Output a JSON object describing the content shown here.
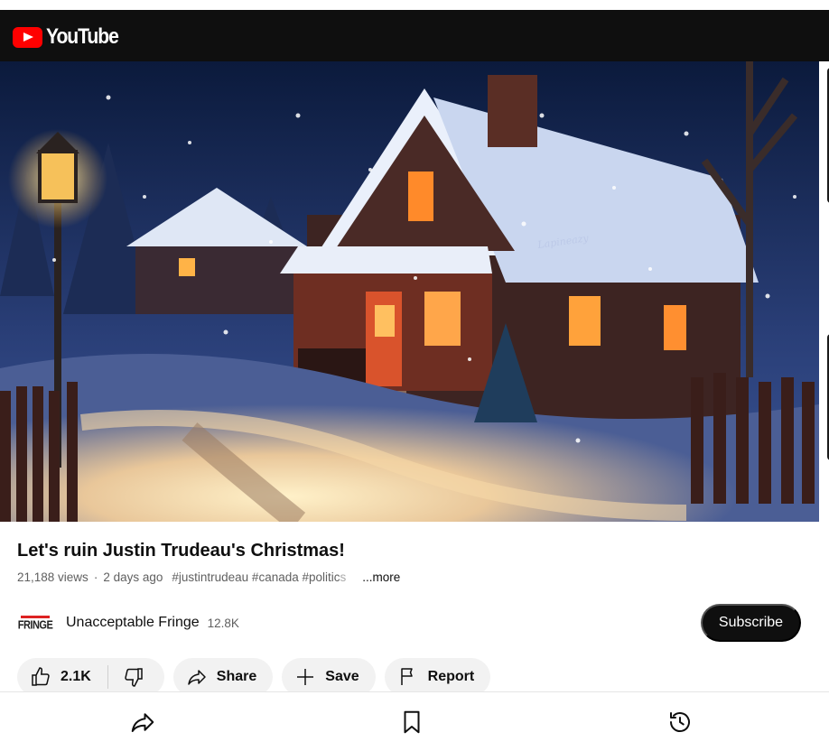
{
  "app": {
    "name": "YouTube"
  },
  "video": {
    "title": "Let's ruin Justin Trudeau's Christmas!",
    "views": "21,188 views",
    "age": "2 days ago",
    "separator": "·",
    "tags": "#justintrudeau #canada #politic",
    "tags_fade": "s",
    "more_label": "...more",
    "watermark": "Lapineazy"
  },
  "channel": {
    "avatar_text": "FRINGE",
    "name": "Unacceptable Fringe",
    "subscribers": "12.8K",
    "subscribe_label": "Subscribe"
  },
  "actions": {
    "likes": "2.1K",
    "share_label": "Share",
    "save_label": "Save",
    "report_label": "Report"
  },
  "bottom_nav": {
    "icons": [
      "share-icon",
      "bookmark-icon",
      "history-icon"
    ]
  },
  "colors": {
    "brand_red": "#ff0000",
    "appbar": "#0f0f0f",
    "pill_bg": "#f2f2f2",
    "subscribe_bg": "#0f0f0f"
  }
}
